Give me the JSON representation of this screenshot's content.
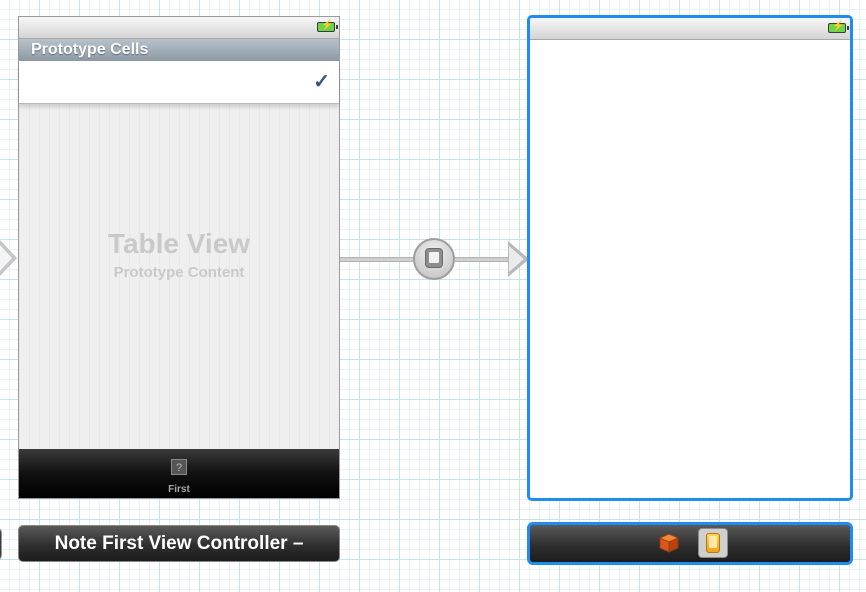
{
  "table_scene": {
    "section_header": "Prototype Cells",
    "cell_accessory": "✓",
    "placeholder_title": "Table View",
    "placeholder_subtitle": "Prototype Content",
    "tab_item": {
      "icon": "?",
      "label": "First"
    }
  },
  "table_scene_dock": {
    "title": "Note First View Controller –"
  },
  "segue": {
    "icon": "modal-segue-icon"
  },
  "view_scene": {
    "selected": true
  },
  "view_scene_dock": {
    "icons": [
      "first-responder-cube-icon",
      "view-controller-icon"
    ]
  },
  "colors": {
    "selection": "#1e8cf0",
    "tint": "#385487",
    "battery": "#6bd54a"
  }
}
